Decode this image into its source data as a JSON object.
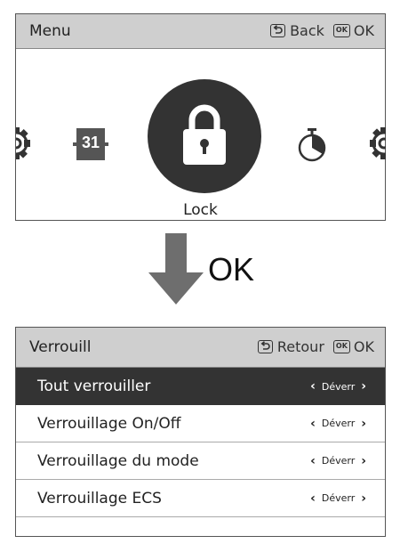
{
  "menu_screen": {
    "title": "Menu",
    "back_label": "Back",
    "ok_badge": "OK",
    "ok_label": "OK",
    "calendar_number": "31",
    "selected_item_label": "Lock",
    "icons": [
      "gear-icon",
      "calendar-icon",
      "lock-icon",
      "timer-icon",
      "gear-icon"
    ]
  },
  "transition": {
    "label": "OK"
  },
  "lock_screen": {
    "title": "Verrouill",
    "back_label": "Retour",
    "ok_badge": "OK",
    "ok_label": "OK",
    "rows": [
      {
        "label": "Tout verrouiller",
        "value": "Déverr",
        "selected": true
      },
      {
        "label": "Verrouillage On/Off",
        "value": "Déverr",
        "selected": false
      },
      {
        "label": "Verrouillage du mode",
        "value": "Déverr",
        "selected": false
      },
      {
        "label": "Verrouillage ECS",
        "value": "Déverr",
        "selected": false
      }
    ]
  },
  "colors": {
    "header_bg": "#cfcfcf",
    "selected_bg": "#333333",
    "icon_dark": "#333333",
    "arrow_gray": "#6e6e6e"
  }
}
